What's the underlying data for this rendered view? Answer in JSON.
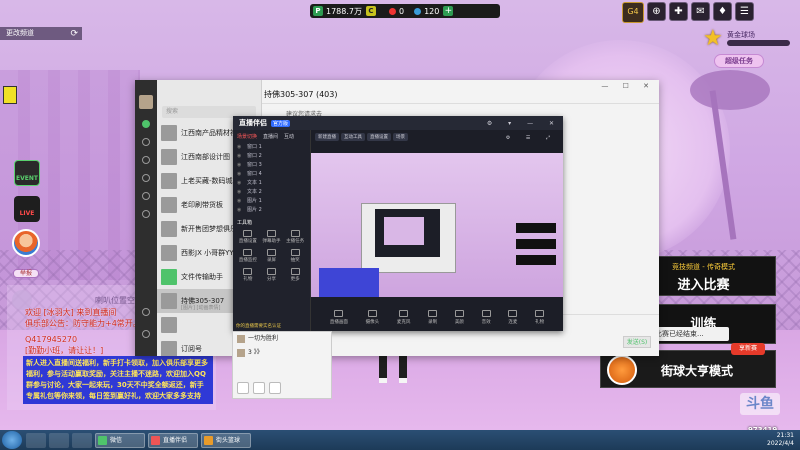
{
  "hud": {
    "currency_p_icon": "P",
    "currency_p": "1788.7万",
    "currency_c_icon": "C",
    "coin_value": "0",
    "energy_value": "120",
    "add_label": "+"
  },
  "top_left": {
    "label": "更改频道",
    "refresh_icon": "⟳"
  },
  "top_right": {
    "icons": [
      {
        "name": "vip-icon",
        "glyph": "G4"
      },
      {
        "name": "add-friend-icon",
        "glyph": "⊕"
      },
      {
        "name": "gift-icon",
        "glyph": "✚"
      },
      {
        "name": "mail-icon",
        "glyph": "✉"
      },
      {
        "name": "hint-icon",
        "glyph": "♦"
      },
      {
        "name": "menu-icon",
        "glyph": "☰"
      }
    ]
  },
  "rank": {
    "name": "黄金球场",
    "progress_fraction": 0
  },
  "mission": {
    "label": "超级任务"
  },
  "side": {
    "event_label": "EVENT",
    "live_label": "LIVE",
    "face_tag": "举报"
  },
  "chat": {
    "hint": "喇叭位置空",
    "lines": [
      "欢迎 [冰羽大] 来到直播间",
      "俱乐部公告：防守能力+4常开。嘉",
      "Q417945270",
      "[勤勤小班，请让让！]"
    ],
    "block": "新人进入直播间送福利，新手打卡领取，加入俱乐部享更多福利，参与活动赢取奖励，关注主播不迷路，欢迎加入QQ群参与讨论，大家一起来玩，30天不中奖全额返还，新手专属礼包等你来领，每日签到赢好礼，欢迎大家多多支持"
  },
  "modes": {
    "mode1_sub": "竞技频道 - 传奇模式",
    "mode1_main": "进入比赛",
    "mode2_main": "训练",
    "mode2_tip": "模拟比赛已经结束...",
    "mode3_main": "街球大亨模式",
    "mode3_badge": "享新赛"
  },
  "douyu": {
    "logo": "斗鱼",
    "room_id": "973419"
  },
  "wechat": {
    "title": "持佛305-307 (403)",
    "note": "建议您请求去",
    "search_placeholder": "搜索",
    "send_label": "发送(S)",
    "win_btns": "— ☐ ✕",
    "items": [
      {
        "name": "江西南产品精材社会",
        "sub": ""
      },
      {
        "name": "江西南部设计图",
        "sub": ""
      },
      {
        "name": "上老买藏-数码城",
        "sub": ""
      },
      {
        "name": "老印刷带货板",
        "sub": ""
      },
      {
        "name": "新开售团梦想俱乐部",
        "sub": ""
      },
      {
        "name": "西影JX 小哥群YY",
        "sub": ""
      },
      {
        "name": "文件传输助手",
        "sub": ""
      },
      {
        "name": "持佛305-307",
        "sub": "[图片] [动画表情]"
      },
      {
        "name": "",
        "sub": ""
      },
      {
        "name": "订阅号",
        "sub": ""
      }
    ]
  },
  "obs": {
    "logo": "直播伴侣",
    "tag": "官方版",
    "window_btns": "⚙ ▾ — ✕",
    "tabs": [
      "场景切换",
      "直播间",
      "互动"
    ],
    "scenes": [
      "窗口 1",
      "窗口 2",
      "窗口 3",
      "窗口 4",
      "文本 1",
      "文本 2",
      "图片 1",
      "图片 2"
    ],
    "tools_title": "工具箱",
    "tools": [
      "直播设置",
      "弹幕助手",
      "主播任务",
      "直播监控",
      "录屏",
      "抽奖",
      "礼物",
      "分享",
      "更多"
    ],
    "status": "你的直播需要实名认证",
    "topbar_btns": [
      "新建直播",
      "互动工具",
      "直播设置",
      "场景"
    ],
    "topbar_icons": "⚙ ☰ ⤢",
    "bottom_tools": [
      "直播画面",
      "摄像头",
      "麦克风",
      "录制",
      "美颜",
      "音效",
      "连麦",
      "礼物"
    ]
  },
  "wx_mini": {
    "rows": [
      "一切为胜利",
      "3 》》"
    ]
  },
  "taskbar": {
    "tasks": [
      {
        "label": "微信",
        "cls": ""
      },
      {
        "label": "直播伴侣",
        "cls": "obsi"
      },
      {
        "label": "街头篮球",
        "cls": "game"
      }
    ],
    "time": "21:31",
    "date": "2022/4/4"
  }
}
